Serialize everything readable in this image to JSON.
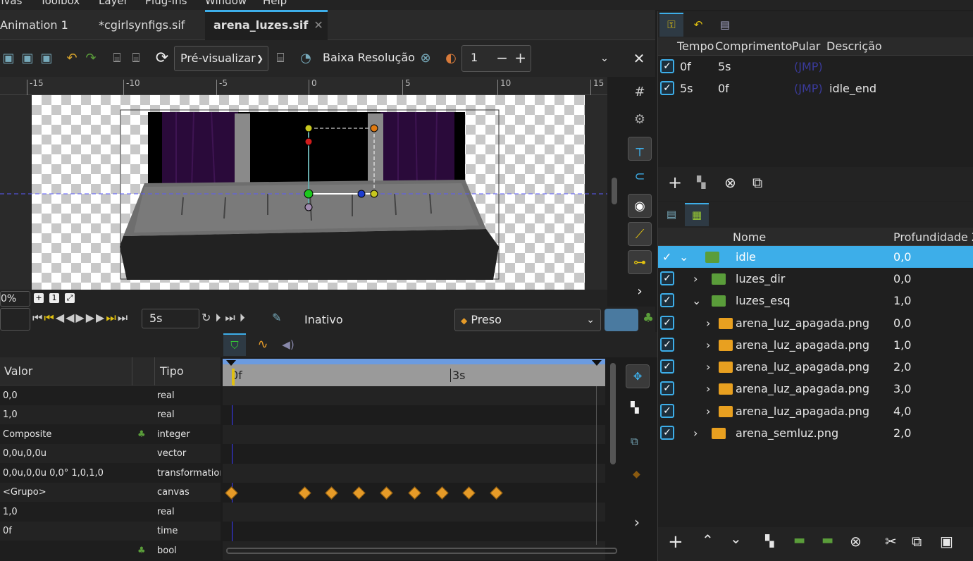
{
  "menu": [
    "nvas",
    "Toolbox",
    "Layer",
    "Plug-Ins",
    "Window",
    "Help"
  ],
  "tabs": [
    "Animation 1",
    "*cgirlsynfigs.sif",
    "arena_luzes.sif"
  ],
  "toolbar": {
    "preview_label": "Pré-visualizar",
    "lowres_label": "Baixa Resolução",
    "onion_value": "1"
  },
  "ruler": [
    "-15",
    "-10",
    "-5",
    "0",
    "5",
    "10",
    "15"
  ],
  "zoom": "0%",
  "time_field": "5s",
  "status": "Inativo",
  "interp": "Preso",
  "params": {
    "headers": {
      "value": "Valor",
      "type": "Tipo"
    },
    "rows": [
      {
        "value": "0,0",
        "type": "real"
      },
      {
        "value": "1,0",
        "type": "real"
      },
      {
        "value": "Composite",
        "type": "integer"
      },
      {
        "value": "0,0u,0,0u",
        "type": "vector"
      },
      {
        "value": "0,0u,0,0u 0,0° 1,0,1,0",
        "type": "transformation"
      },
      {
        "value": "<Grupo>",
        "type": "canvas"
      },
      {
        "value": "1,0",
        "type": "real"
      },
      {
        "value": "0f",
        "type": "time"
      },
      {
        "value": "",
        "type": "bool"
      }
    ]
  },
  "timeline": {
    "start": "0f",
    "mid": "3s"
  },
  "keyframes": {
    "headers": {
      "time": "Tempo",
      "length": "Comprimento",
      "jump": "Pular",
      "desc": "Descrição"
    },
    "rows": [
      {
        "time": "0f",
        "length": "5s",
        "jump": "(JMP)",
        "desc": ""
      },
      {
        "time": "5s",
        "length": "0f",
        "jump": "(JMP)",
        "desc": "idle_end"
      }
    ]
  },
  "layers": {
    "headers": {
      "name": "Nome",
      "depth": "Profundidade Z"
    },
    "rows": [
      {
        "name": "idle",
        "depth": "0,0"
      },
      {
        "name": "luzes_dir",
        "depth": "0,0"
      },
      {
        "name": "luzes_esq",
        "depth": "1,0"
      },
      {
        "name": "arena_luz_apagada.png",
        "depth": "0,0"
      },
      {
        "name": "arena_luz_apagada.png",
        "depth": "1,0"
      },
      {
        "name": "arena_luz_apagada.png",
        "depth": "2,0"
      },
      {
        "name": "arena_luz_apagada.png",
        "depth": "3,0"
      },
      {
        "name": "arena_luz_apagada.png",
        "depth": "4,0"
      },
      {
        "name": "arena_semluz.png",
        "depth": "2,0"
      }
    ]
  },
  "colors": {
    "accent": "#3daee9",
    "keyframe": "#e69b28",
    "selected_row": "#3daee9"
  }
}
